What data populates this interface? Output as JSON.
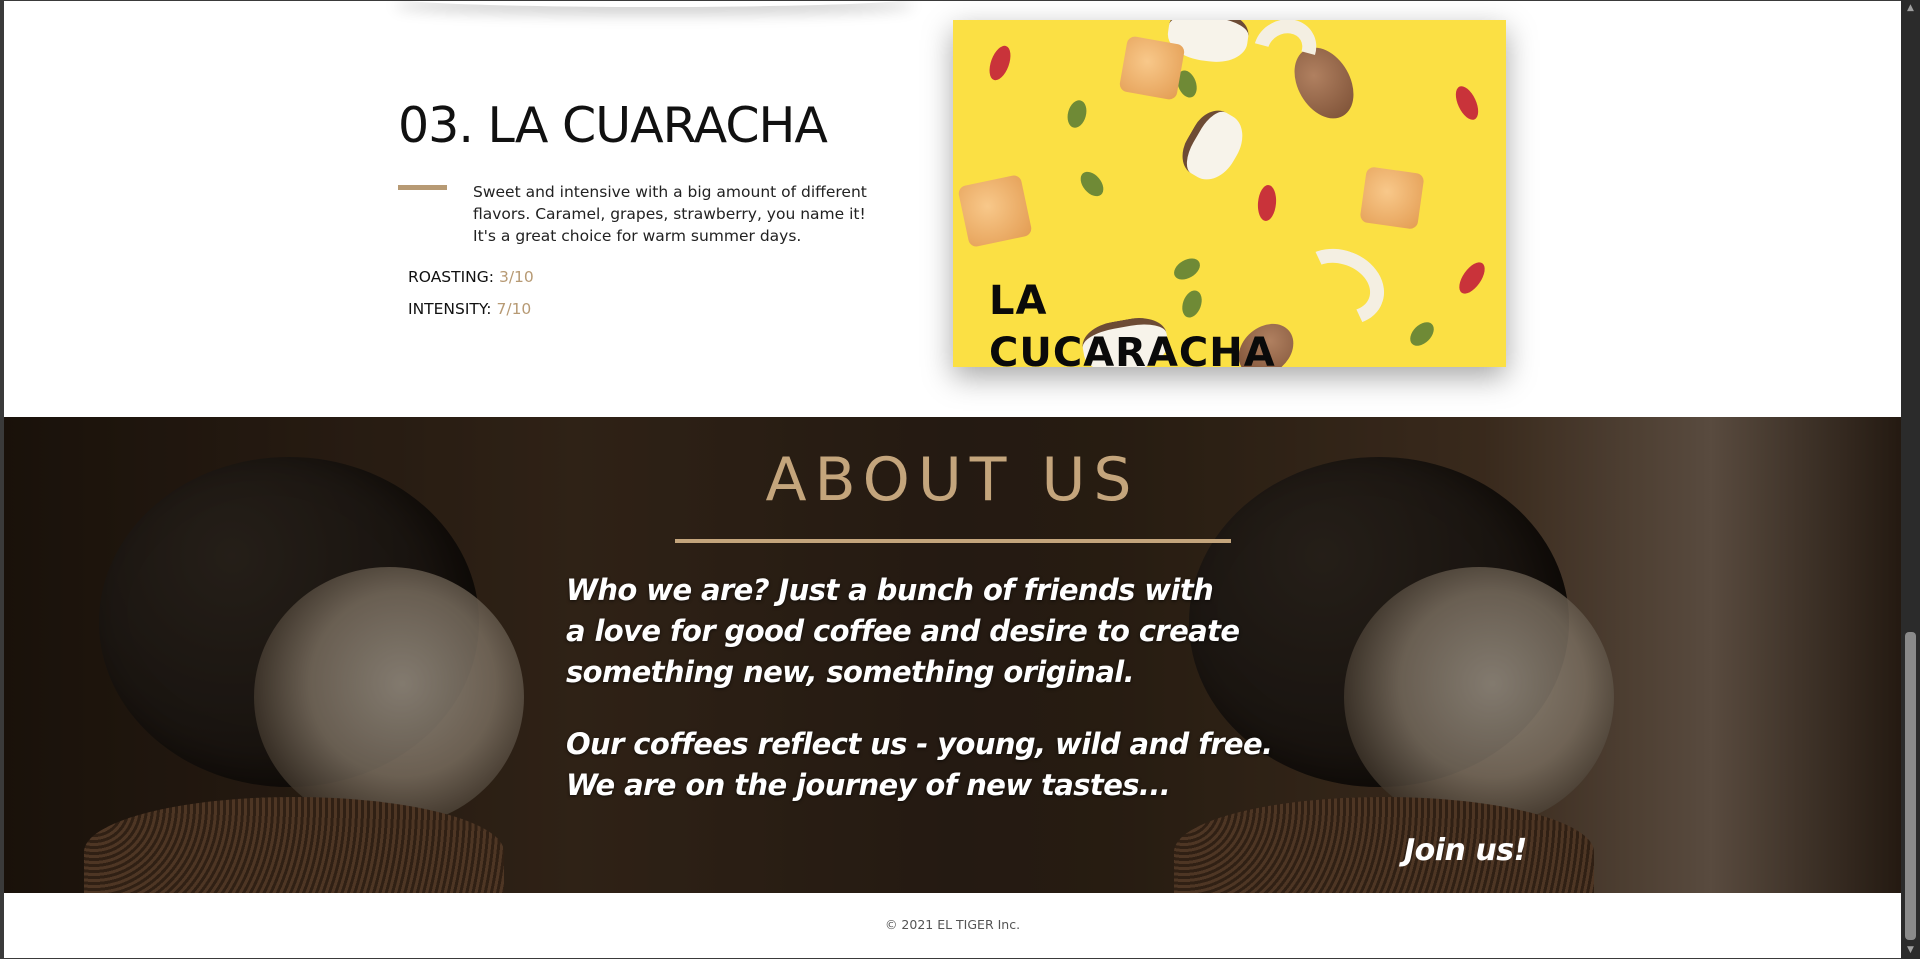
{
  "product": {
    "title": "03. LA CUARACHA",
    "description": "Sweet and intensive with a big amount of different flavors. Caramel, grapes, strawberry, you name it! It's a great choice for warm summer days.",
    "roasting_label": "ROASTING:",
    "roasting_value": "3/10",
    "intensity_label": "INTENSITY:",
    "intensity_value": "7/10",
    "image_caption_line1": "LA",
    "image_caption_line2": "CUCARACHA"
  },
  "about": {
    "title": "ABOUT US",
    "para1": [
      "Who we are? Just a bunch of friends with",
      "a love for good coffee and desire to create",
      "something new, something original."
    ],
    "para2": [
      "Our coffees reflect us - young, wild and free.",
      "We are on the journey of new tastes..."
    ],
    "join_label": "Join us!"
  },
  "footer": {
    "copyright": "© 2021 EL TIGER Inc."
  },
  "colors": {
    "accent": "#b79a74",
    "about_title": "#c4a57c",
    "image_background": "#fbe044"
  },
  "scrollbar": {
    "up_icon": "▲",
    "down_icon": "▼"
  }
}
